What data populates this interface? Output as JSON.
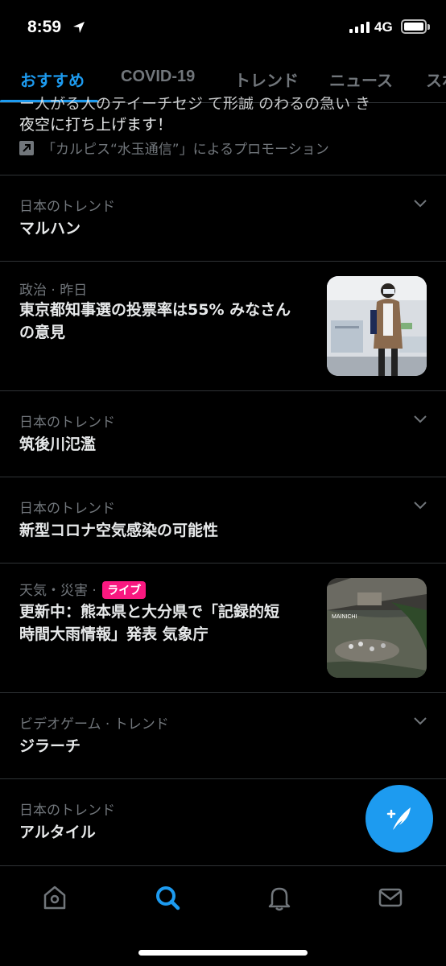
{
  "status_bar": {
    "time": "8:59",
    "network": "4G"
  },
  "tabs": [
    {
      "label": "おすすめ",
      "active": true
    },
    {
      "label": "COVID-19"
    },
    {
      "label": "トレンド"
    },
    {
      "label": "ニュース"
    },
    {
      "label": "スポ"
    }
  ],
  "promo": {
    "text_partial": "ー人がる人のテイーチセジ て形誠 のわるの急い き",
    "text": "夜空に打ち上げます！",
    "label": "「カルピス“水玉通信”」によるプロモーション"
  },
  "feed": [
    {
      "meta": "日本のトレンド",
      "title": "マルハン"
    },
    {
      "meta": "政治 · 昨日",
      "title_lines": [
        "東京都知事選の投票率は55% みなさん",
        "の意見"
      ]
    },
    {
      "meta": "日本のトレンド",
      "title": "筑後川氾濫"
    },
    {
      "meta": "日本のトレンド",
      "title": "新型コロナ空気感染の可能性"
    },
    {
      "meta": "天気・災害 ·",
      "badge": "ライブ",
      "title_lines": [
        "更新中：熊本県と大分県で「記録的短",
        "時間大雨情報」発表 気象庁"
      ],
      "thumb_text": "MAINICHI"
    },
    {
      "meta": "ビデオゲーム · トレンド",
      "title": "ジラーチ"
    },
    {
      "meta": "日本のトレンド",
      "title": "アルタイル"
    }
  ],
  "colors": {
    "accent": "#1d9bf0",
    "live": "#f91880",
    "muted": "#71767b",
    "divider": "#2f3336"
  },
  "icons": [
    "location-arrow-icon",
    "chevron-down-icon",
    "external-link-icon",
    "compose-quill-icon",
    "home-icon",
    "search-icon",
    "bell-icon",
    "mail-icon"
  ]
}
